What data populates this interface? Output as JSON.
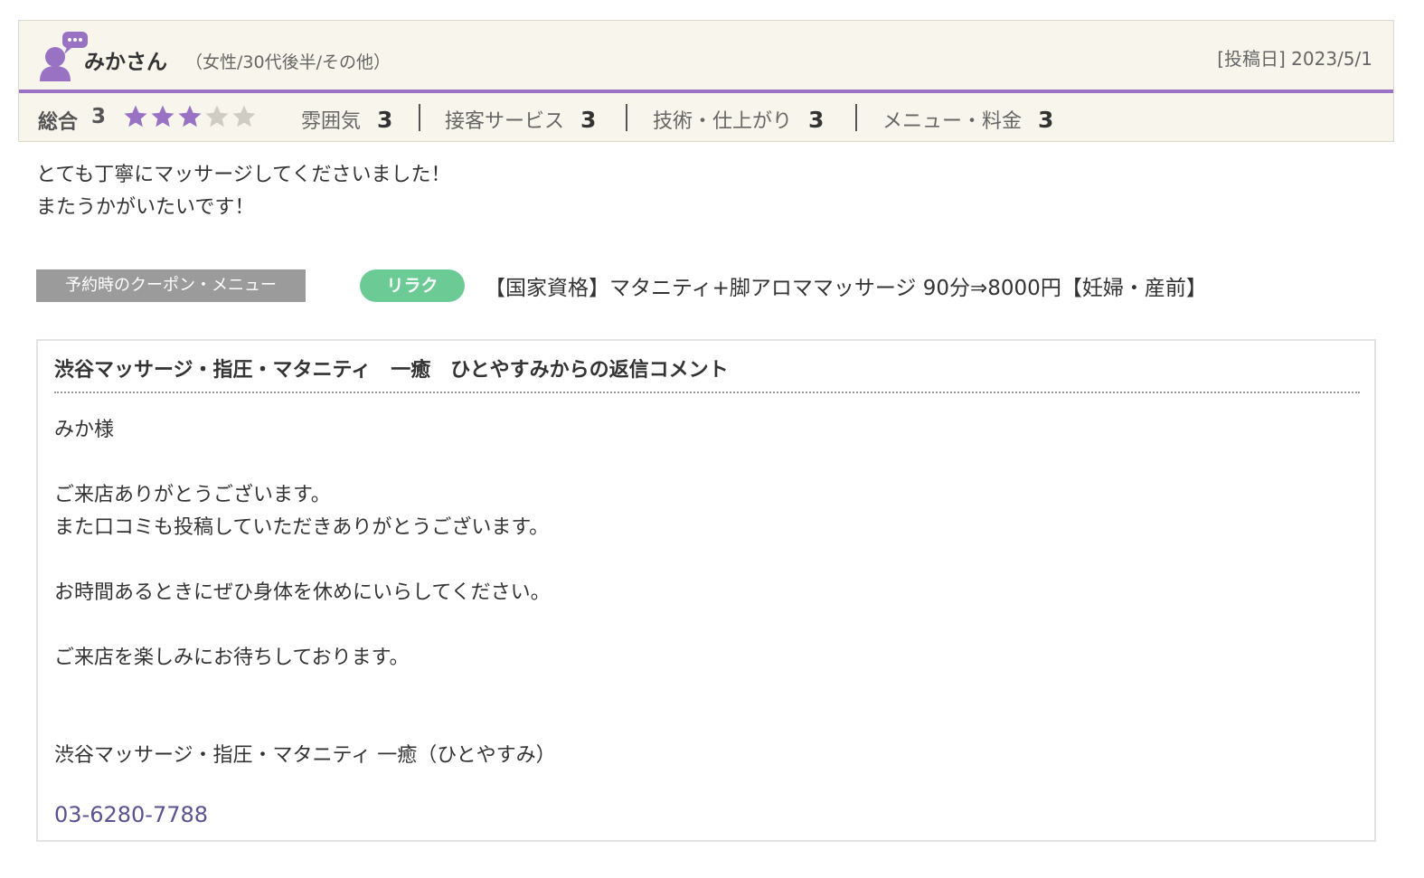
{
  "reviewer": {
    "name": "みかさん",
    "attributes": "（女性/30代後半/その他）",
    "post_date": "[投稿日] 2023/5/1"
  },
  "rating": {
    "overall_label": "総合",
    "overall_score": "3",
    "stars_filled": 3,
    "stars_total": 5,
    "items": [
      {
        "label": "雰囲気",
        "score": "3"
      },
      {
        "label": "接客サービス",
        "score": "3"
      },
      {
        "label": "技術・仕上がり",
        "score": "3"
      },
      {
        "label": "メニュー・料金",
        "score": "3"
      }
    ]
  },
  "comment": {
    "line1": "とても丁寧にマッサージしてくださいました！",
    "line2": "またうかがいたいです！"
  },
  "coupon": {
    "tag_label": "予約時のクーポン・メニュー",
    "category_label": "リラク",
    "menu_text": "【国家資格】マタニティ+脚アロママッサージ 90分⇒8000円【妊婦・産前】"
  },
  "reply": {
    "title": "渋谷マッサージ・指圧・マタニティ　一癒　ひとやすみからの返信コメント",
    "line1": "みか様",
    "line2": "ご来店ありがとうございます。",
    "line3": "また口コミも投稿していただきありがとうございます。",
    "line4": "お時間あるときにぜひ身体を休めにいらしてください。",
    "line5": "ご来店を楽しみにお待ちしております。",
    "signature": "渋谷マッサージ・指圧・マタニティ 一癒（ひとやすみ）",
    "phone": "03-6280-7788"
  },
  "colors": {
    "accent_purple": "#9a72c4",
    "star_filled": "#9a72c4",
    "star_empty": "#d0ccc4",
    "relax_green": "#6ccb95",
    "phone_link": "#5b5190"
  }
}
